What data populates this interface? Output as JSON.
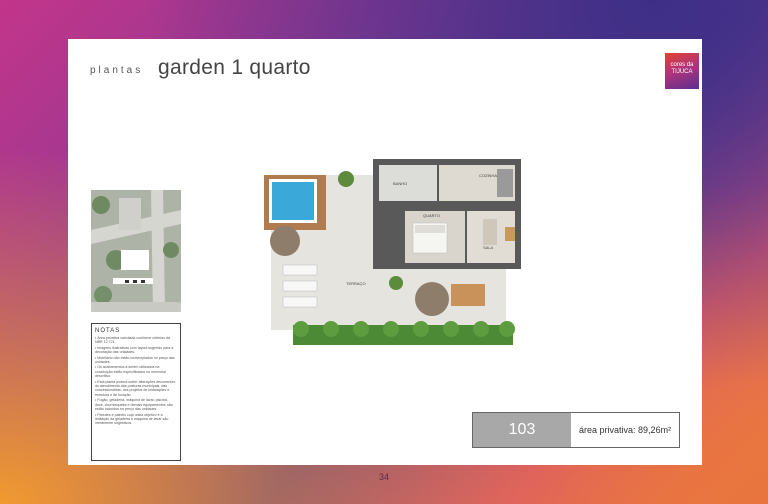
{
  "header": {
    "prefix": "plantas",
    "title": "garden 1 quarto"
  },
  "logo": {
    "line1": "cores da",
    "line2": "TIJUCA"
  },
  "notes": {
    "title": "NOTAS",
    "items": [
      "• Área privativa calculada conforme critérios da NBR 12.721.",
      "• Imagens ilustrativas com layout sugerido para a decoração das unidades.",
      "• Mobiliário não estão contemplados no preço das unidades.",
      "• Os acabamentos a serem utilizados na construção estão especificados no memorial descritivo.",
      "• Esta planta poderá sofrer alterações decorrentes do atendimento das posturas municipais, das concessionárias, dos projetos de instalações e estrutura e de locação.",
      "• Fogão, geladeira, máquina de lavar, piscina, deck, churrasqueira e demais equipamentos não estão incluídos no preço das unidades.",
      "• Paredes e painéis cuja única objetivo é a limitação da geladeira e máquina de lavar são meramente sugestivos."
    ]
  },
  "plan": {
    "labels": {
      "banho": "BANHO",
      "cozinha": "COZINHA",
      "quarto": "QUARTO",
      "sala": "SALA",
      "terraco": "TERRAÇO"
    }
  },
  "unit": {
    "number": "103",
    "area_label": "área privativa:",
    "area_value": "89,26m²"
  },
  "footer": {
    "page_number": "34"
  },
  "colors": {
    "accent": "#8c3a95",
    "unit_box": "#a8a8a8"
  }
}
